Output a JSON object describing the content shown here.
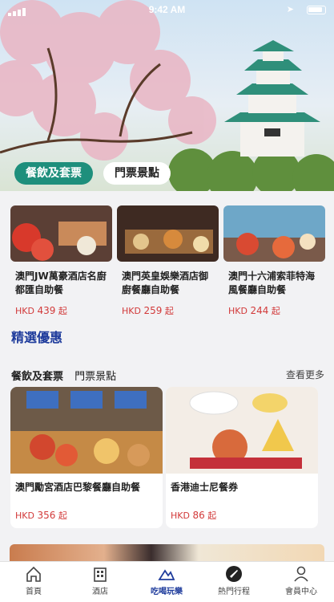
{
  "status_bar": {
    "time": "9:42 AM"
  },
  "hero": {
    "chips": [
      {
        "label": "餐飲及套票",
        "selected": true
      },
      {
        "label": "門票景點",
        "selected": false
      }
    ]
  },
  "top_cards": [
    {
      "name": "澳門JW萬豪酒店名廚都匯自助餐",
      "currency": "HKD",
      "price": "439",
      "suffix": "起"
    },
    {
      "name": "澳門英皇娛樂酒店御廚餐廳自助餐",
      "currency": "HKD",
      "price": "259",
      "suffix": "起"
    },
    {
      "name": "澳門十六浦索菲特海風餐廳自助餐",
      "currency": "HKD",
      "price": "244",
      "suffix": "起"
    }
  ],
  "featured": {
    "title": "精選優惠",
    "tabs": [
      "餐飲及套票",
      "門票景點"
    ],
    "more_label": "查看更多",
    "cards": [
      {
        "name": "澳門勵宮酒店巴黎餐廳自助餐",
        "currency": "HKD",
        "price": "356",
        "suffix": "起"
      },
      {
        "name": "香港迪士尼餐券",
        "currency": "HKD",
        "price": "86",
        "suffix": "起"
      }
    ]
  },
  "bottom_nav": [
    {
      "label": "首頁",
      "icon": "home-icon",
      "active": false
    },
    {
      "label": "酒店",
      "icon": "hotel-icon",
      "active": false
    },
    {
      "label": "吃喝玩樂",
      "icon": "mountain-icon",
      "active": true
    },
    {
      "label": "熱門行程",
      "icon": "plane-icon",
      "active": false
    },
    {
      "label": "會員中心",
      "icon": "user-icon",
      "active": false
    }
  ],
  "colors": {
    "accent": "#1e8f7c",
    "brand_blue": "#1f3c9c",
    "price_red": "#d23a3a"
  }
}
